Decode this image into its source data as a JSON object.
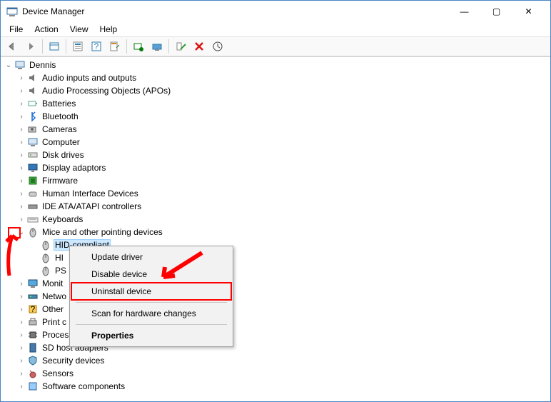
{
  "window": {
    "title": "Device Manager",
    "min": "—",
    "max": "▢",
    "close": "✕"
  },
  "menu": {
    "file": "File",
    "action": "Action",
    "view": "View",
    "help": "Help"
  },
  "tree": {
    "root": "Dennis",
    "items": [
      "Audio inputs and outputs",
      "Audio Processing Objects (APOs)",
      "Batteries",
      "Bluetooth",
      "Cameras",
      "Computer",
      "Disk drives",
      "Display adaptors",
      "Firmware",
      "Human Interface Devices",
      "IDE ATA/ATAPI controllers",
      "Keyboards"
    ],
    "mice_label": "Mice and other pointing devices",
    "mice_children": [
      "HID-compliant",
      "HI",
      "PS"
    ],
    "after": [
      "Monit",
      "Netwo",
      "Other ",
      "Print c",
      "Proces",
      "SD host adapters",
      "Security devices",
      "Sensors",
      "Software components"
    ]
  },
  "context_menu": {
    "update": "Update driver",
    "disable": "Disable device",
    "uninstall": "Uninstall device",
    "scan": "Scan for hardware changes",
    "properties": "Properties"
  }
}
